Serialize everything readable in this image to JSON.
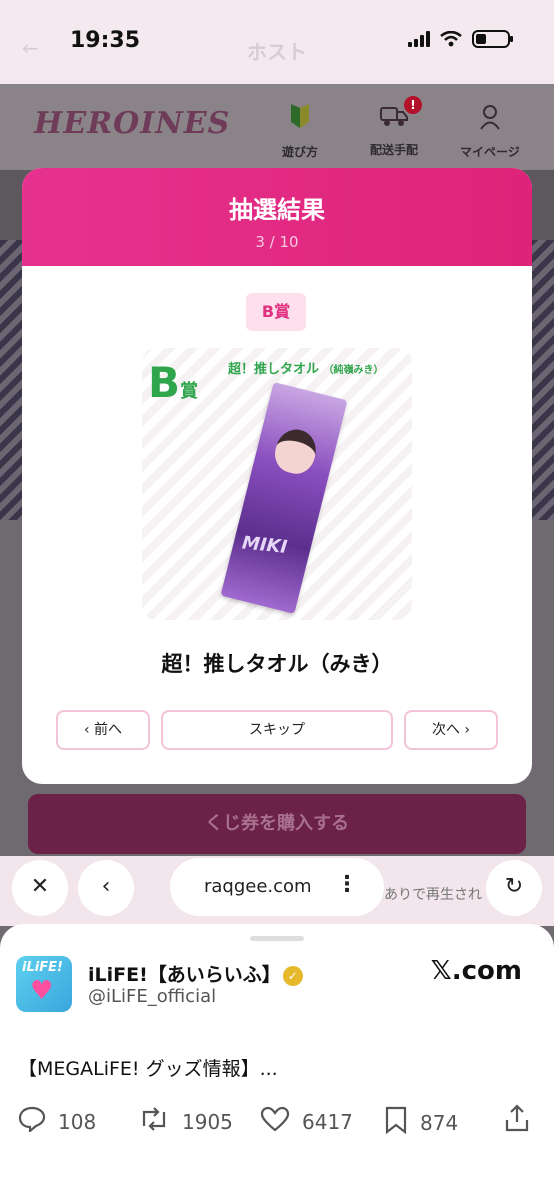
{
  "status_bar": {
    "time": "19:35"
  },
  "browser_page": {
    "faded_title": "ホスト",
    "faded_back": "←"
  },
  "site_header": {
    "logo": "HEROINES",
    "nav": [
      {
        "label": "遊び方",
        "icon": "beginner-mark-icon"
      },
      {
        "label": "配送手配",
        "icon": "truck-icon",
        "badge": "!"
      },
      {
        "label": "マイページ",
        "icon": "person-icon"
      }
    ]
  },
  "modal": {
    "title": "抽選結果",
    "counter": "3 / 10",
    "rank_badge": "B賞",
    "card_rank": "B",
    "card_rank_suffix": "賞",
    "card_item_name": "超！推しタオル",
    "card_item_sub": "（純嶺みき）",
    "card_towel_text": "MIKI",
    "prize_title": "超！推しタオル（みき）",
    "prev_label": "前へ",
    "skip_label": "スキップ",
    "next_label": "次へ"
  },
  "buy_button_label": "くじ券を購入する",
  "browser": {
    "url": "raqgee.com",
    "behind_text": "ありで再生され",
    "close_icon": "close-icon",
    "back_icon": "chevron-left-icon",
    "reload_icon": "reload-icon"
  },
  "share": {
    "account_name": "iLiFE!【あいらいふ】",
    "handle": "@iLiFE_official",
    "source": "𝕏.com",
    "avatar_text": "iLiFE!",
    "post_text": "【MEGALiFE! グッズ情報】...",
    "replies": "108",
    "reposts": "1905",
    "likes": "6417",
    "bookmarks": "874"
  }
}
